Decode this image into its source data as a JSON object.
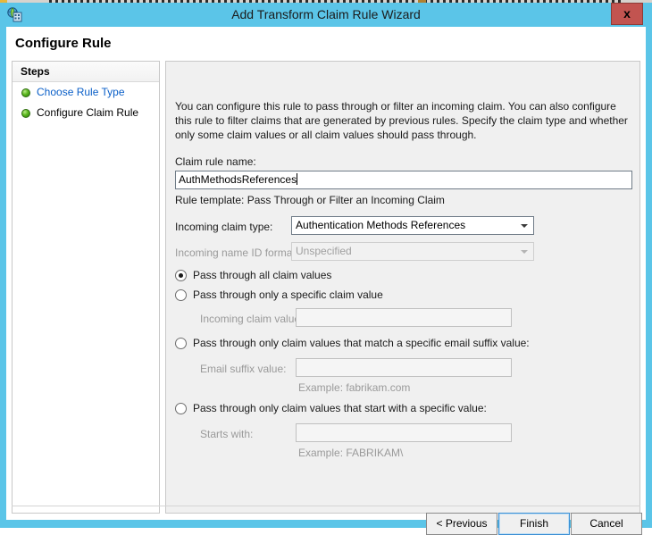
{
  "window": {
    "title": "Add Transform Claim Rule Wizard",
    "icon": "adfs-globe-icon",
    "close_label": "x",
    "titlebar_color": "#5bc5e8",
    "close_color": "#c25450"
  },
  "page": {
    "heading": "Configure Rule"
  },
  "sidebar": {
    "header": "Steps",
    "items": [
      {
        "label": "Choose Rule Type",
        "state": "link"
      },
      {
        "label": "Configure Claim Rule",
        "state": "current"
      }
    ]
  },
  "main": {
    "description": "You can configure this rule to pass through or filter an incoming claim. You can also configure this rule to filter claims that are generated by previous rules. Specify the claim type and whether only some claim values or all claim values should pass through.",
    "rule_name_label": "Claim rule name:",
    "rule_name_value": "AuthMethodsReferences",
    "rule_template_text": "Rule template: Pass Through or Filter an Incoming Claim",
    "incoming_claim_type_label": "Incoming claim type:",
    "incoming_claim_type_value": "Authentication Methods References",
    "incoming_name_id_label": "Incoming name ID format:",
    "incoming_name_id_value": "Unspecified",
    "options": [
      {
        "label": "Pass through all claim values",
        "selected": true,
        "field_label": null,
        "field_value": null,
        "example": null
      },
      {
        "label": "Pass through only a specific claim value",
        "selected": false,
        "field_label": "Incoming claim value:",
        "field_value": "",
        "example": null
      },
      {
        "label": "Pass through only claim values that match a specific email suffix value:",
        "selected": false,
        "field_label": "Email suffix value:",
        "field_value": "",
        "example": "Example: fabrikam.com"
      },
      {
        "label": "Pass through only claim values that start with a specific value:",
        "selected": false,
        "field_label": "Starts with:",
        "field_value": "",
        "example": "Example: FABRIKAM\\"
      }
    ]
  },
  "footer": {
    "previous_label": "< Previous",
    "finish_label": "Finish",
    "cancel_label": "Cancel"
  }
}
